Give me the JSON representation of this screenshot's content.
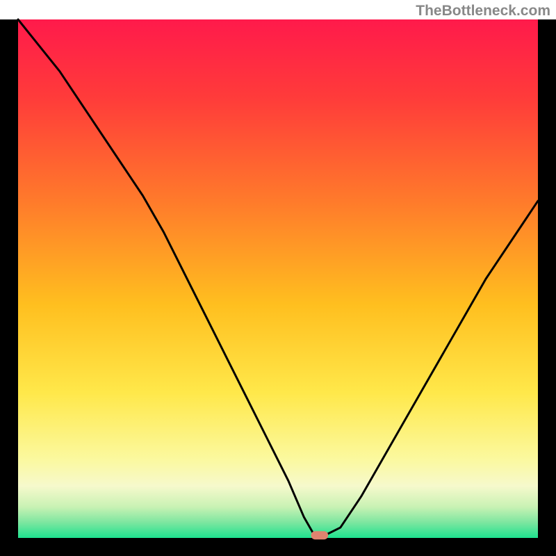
{
  "watermark": "TheBottleneck.com",
  "chart_data": {
    "type": "line",
    "title": "",
    "xlabel": "",
    "ylabel": "",
    "xlim": [
      0,
      100
    ],
    "ylim": [
      0,
      100
    ],
    "grid": false,
    "legend": false,
    "frame": {
      "left": true,
      "right": true,
      "top": false,
      "bottom": true,
      "color": "#000000",
      "thickness_px": 26
    },
    "background_gradient": {
      "type": "vertical",
      "stops": [
        {
          "pos": 0.0,
          "color": "#ff1a4b"
        },
        {
          "pos": 0.15,
          "color": "#ff3b3a"
        },
        {
          "pos": 0.35,
          "color": "#ff7a2b"
        },
        {
          "pos": 0.55,
          "color": "#ffbf1f"
        },
        {
          "pos": 0.72,
          "color": "#ffe84a"
        },
        {
          "pos": 0.85,
          "color": "#fbf9a0"
        },
        {
          "pos": 0.9,
          "color": "#f6f9cc"
        },
        {
          "pos": 0.94,
          "color": "#c9f2b4"
        },
        {
          "pos": 0.97,
          "color": "#7de6a0"
        },
        {
          "pos": 1.0,
          "color": "#1ee28f"
        }
      ]
    },
    "series": [
      {
        "name": "bottleneck-curve",
        "color": "#000000",
        "stroke_width": 3,
        "x": [
          0,
          4,
          8,
          12,
          16,
          20,
          24,
          28,
          32,
          36,
          40,
          44,
          48,
          52,
          55,
          57,
          59,
          62,
          66,
          70,
          74,
          78,
          82,
          86,
          90,
          94,
          98,
          100
        ],
        "values": [
          100,
          95,
          90,
          84,
          78,
          72,
          66,
          59,
          51,
          43,
          35,
          27,
          19,
          11,
          4,
          0.5,
          0.5,
          2,
          8,
          15,
          22,
          29,
          36,
          43,
          50,
          56,
          62,
          65
        ]
      }
    ],
    "marker": {
      "name": "optimal-point",
      "x": 58,
      "y": 0.5,
      "shape": "rounded-rect",
      "fill": "#e0836f",
      "width": 3.3,
      "height": 1.6
    }
  }
}
